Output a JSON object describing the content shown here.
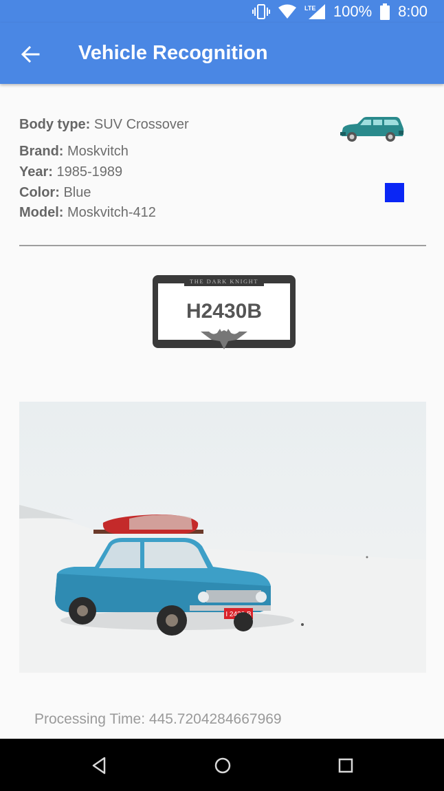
{
  "status_bar": {
    "battery_text": "100%",
    "time": "8:00",
    "icons": [
      "vibrate-icon",
      "wifi-icon",
      "lte-signal-icon",
      "battery-icon"
    ],
    "network_label": "LTE"
  },
  "app_bar": {
    "title": "Vehicle Recognition",
    "back_icon": "arrow-back-icon",
    "background_color": "#4a87e4"
  },
  "vehicle": {
    "body_type_label": "Body type:",
    "body_type_value": " SUV Crossover",
    "brand_label": "Brand:",
    "brand_value": " Moskvitch",
    "year_label": "Year:",
    "year_value": " 1985-1989",
    "color_label": "Color:",
    "color_value": " Blue",
    "color_swatch": "#0a26f5",
    "model_label": "Model:",
    "model_value": " Moskvitch-412",
    "body_icon": "suv-car-icon"
  },
  "plate": {
    "frame_text": "THE DARK KNIGHT",
    "number": "H2430B",
    "emblem_icon": "bat-emblem-icon"
  },
  "photo": {
    "subject": "blue-vintage-car-in-snow-photo",
    "plate_text": "I 2430 B"
  },
  "processing": {
    "label": "Processing Time: ",
    "value": "445.7204284667969"
  },
  "nav_bar": {
    "icons": [
      "back-triangle-icon",
      "home-circle-icon",
      "recents-square-icon"
    ]
  }
}
